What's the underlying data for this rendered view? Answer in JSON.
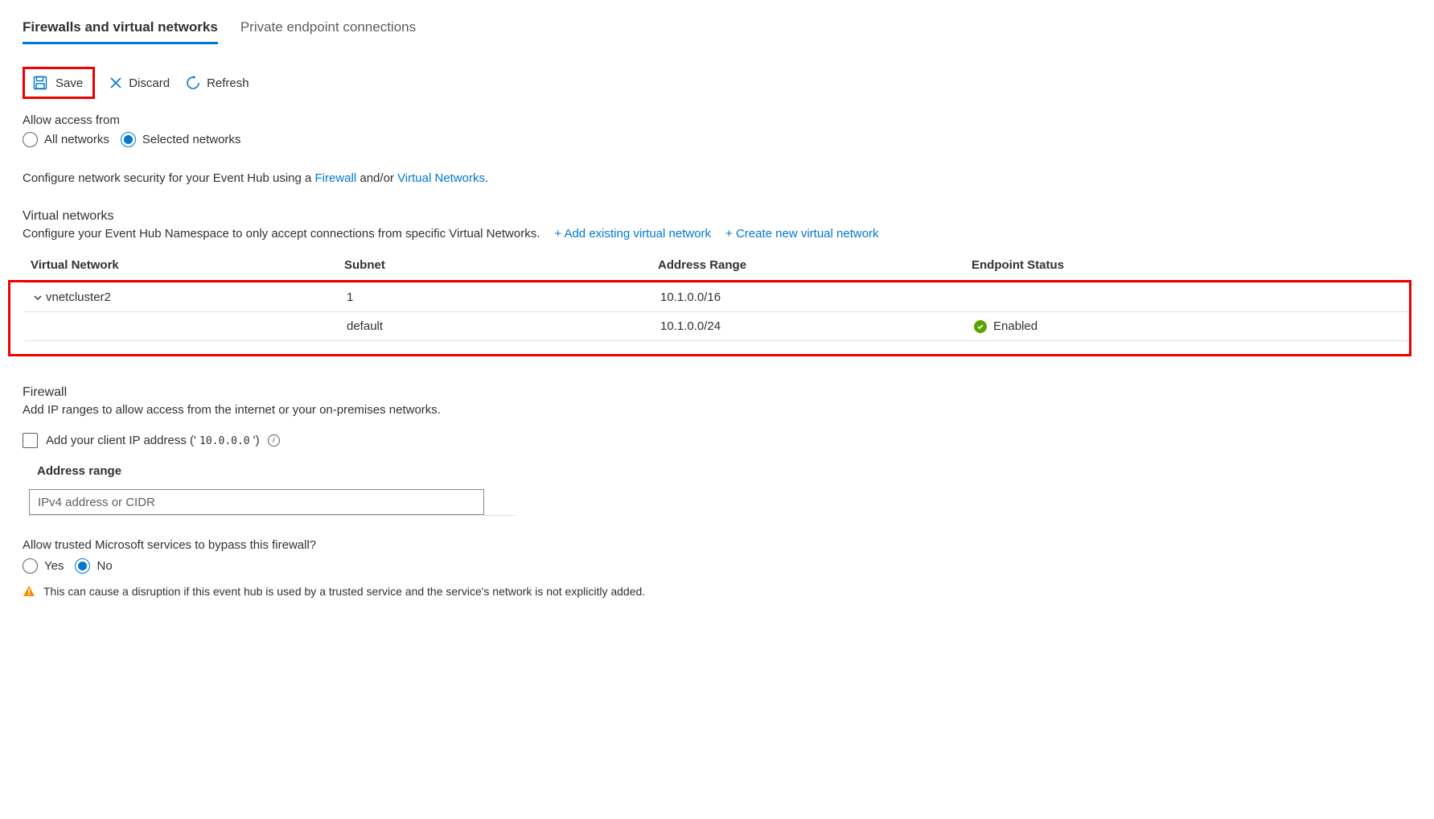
{
  "tabs": {
    "firewalls": "Firewalls and virtual networks",
    "private_endpoints": "Private endpoint connections"
  },
  "toolbar": {
    "save": "Save",
    "discard": "Discard",
    "refresh": "Refresh"
  },
  "access": {
    "label": "Allow access from",
    "all": "All networks",
    "selected": "Selected networks"
  },
  "configure_line": {
    "prefix": "Configure network security for your Event Hub using a ",
    "firewall": "Firewall",
    "mid": " and/or ",
    "vnets": "Virtual Networks",
    "suffix": "."
  },
  "vnet": {
    "title": "Virtual networks",
    "desc": "Configure your Event Hub Namespace to only accept connections from specific Virtual Networks.",
    "add_existing": "+ Add existing virtual network",
    "create_new": "+ Create new virtual network",
    "headers": {
      "vn": "Virtual Network",
      "subnet": "Subnet",
      "range": "Address Range",
      "status": "Endpoint Status"
    },
    "rows": [
      {
        "name": "vnetcluster2",
        "subnet": "1",
        "range": "10.1.0.0/16",
        "status": ""
      },
      {
        "name": "",
        "subnet": "default",
        "range": "10.1.0.0/24",
        "status": "Enabled"
      }
    ]
  },
  "firewall": {
    "title": "Firewall",
    "desc": "Add IP ranges to allow access from the internet or your on-premises networks.",
    "add_client_prefix": "Add your client IP address (' ",
    "client_ip": "10.0.0.0",
    "add_client_suffix": " ')",
    "addr_label": "Address range",
    "addr_placeholder": "IPv4 address or CIDR"
  },
  "trusted": {
    "label": "Allow trusted Microsoft services to bypass this firewall?",
    "yes": "Yes",
    "no": "No",
    "warning": "This can cause a disruption if this event hub is used by a trusted service and the service's network is not explicitly added."
  }
}
